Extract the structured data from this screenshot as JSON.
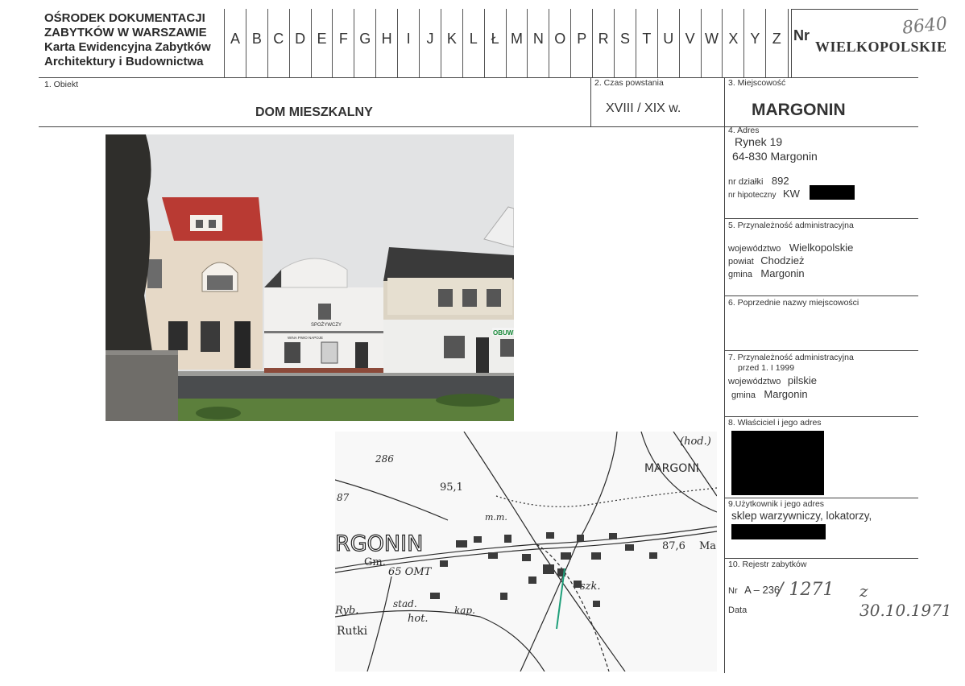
{
  "header": {
    "org_lines": [
      "OŚRODEK DOKUMENTACJI",
      "ZABYTKÓW W WARSZAWIE",
      "Karta Ewidencyjna Zabytków",
      "Architektury i Budownictwa"
    ],
    "letters": [
      "A",
      "B",
      "C",
      "D",
      "E",
      "F",
      "G",
      "H",
      "I",
      "J",
      "K",
      "L",
      "Ł",
      "M",
      "N",
      "O",
      "P",
      "R",
      "S",
      "T",
      "U",
      "V",
      "W",
      "X",
      "Y",
      "Z"
    ],
    "nr_label": "Nr",
    "region": "WIELKOPOLSKIE",
    "card_number": "8640"
  },
  "fields": {
    "f1_label": "1.     Obiekt",
    "f1_value": "DOM MIESZKALNY",
    "f2_label": "2. Czas powstania",
    "f2_value": "XVIII / XIX w.",
    "f3_label": "3. Miejscowość",
    "f3_value": "MARGONIN",
    "f4_label": "4. Adres",
    "f4_street": "Rynek 19",
    "f4_postal": "64-830 Margonin",
    "f4_dzialka_label": "nr działki",
    "f4_dzialka_value": "892",
    "f4_hipo_label": "nr hipoteczny",
    "f4_hipo_value": "KW",
    "f5_label": "5. Przynależność administracyjna",
    "f5_woj_label": "województwo",
    "f5_woj_value": "Wielkopolskie",
    "f5_powiat_label": "powiat",
    "f5_powiat_value": "Chodzież",
    "f5_gmina_label": "gmina",
    "f5_gmina_value": "Margonin",
    "f6_label": "6. Poprzednie nazwy miejscowości",
    "f7_label": "7. Przynależność administracyjna",
    "f7_sub": "przed 1. I 1999",
    "f7_woj_label": "województwo",
    "f7_woj_value": "pilskie",
    "f7_gmina_label": "gmina",
    "f7_gmina_value": "Margonin",
    "f8_label": "8. Właściciel i jego adres",
    "f9_label": "9.Użytkownik i jego adres",
    "f9_value": "sklep warzywniczy, lokatorzy,",
    "f10_label": "10. Rejestr zabytków",
    "f10_nr_label": "Nr",
    "f10_nr_value": "A – 236",
    "f10_handwritten": "/ 1271",
    "f10_date_hand": "z 30.10.1971",
    "f10_data_label": "Data"
  },
  "photo": {
    "signs": [
      "SPOŻYWCZY",
      "WINA  PIWO  NAPOJE",
      "OBUWIE"
    ]
  },
  "map": {
    "labels": [
      "286",
      "(hod.)",
      "MARGONI",
      "95,1",
      "87",
      "m.m.",
      "RGONIN",
      "Gm.",
      "65 OMT",
      "87,6",
      "Ma",
      "Ryb.",
      "stad.",
      "hot.",
      "kap.",
      "szk.",
      "Rutki"
    ]
  }
}
